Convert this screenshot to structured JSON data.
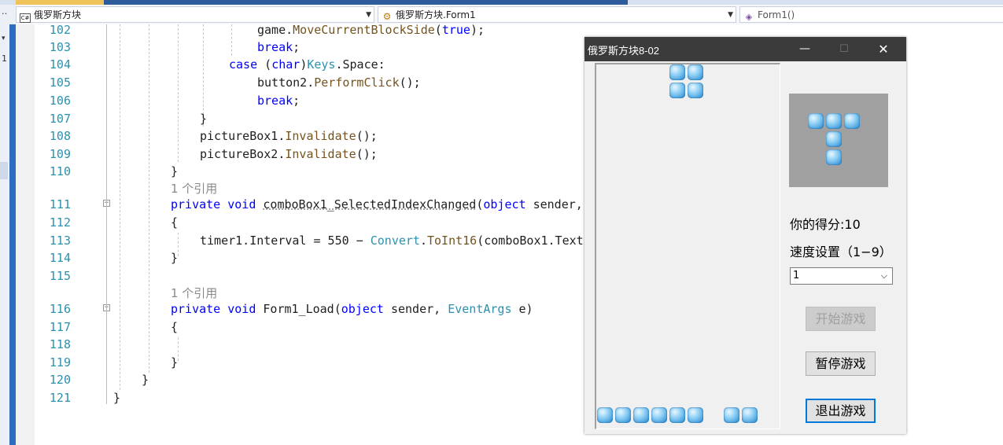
{
  "nav": {
    "project": "俄罗斯方块",
    "class": "俄罗斯方块.Form1",
    "member": "Form1()"
  },
  "left_marks": [
    "‥",
    "1"
  ],
  "lines": [
    {
      "num": "102",
      "code": "game.MoveCurrentBlockSide(true);"
    },
    {
      "num": "103",
      "code": "break;"
    },
    {
      "num": "104",
      "code": "case (char)Keys.Space:"
    },
    {
      "num": "105",
      "code": "button2.PerformClick();"
    },
    {
      "num": "106",
      "code": "break;"
    },
    {
      "num": "107",
      "code": "}"
    },
    {
      "num": "108",
      "code": "pictureBox1.Invalidate();"
    },
    {
      "num": "109",
      "code": "pictureBox2.Invalidate();"
    },
    {
      "num": "110",
      "code": "}"
    },
    {
      "num": "111",
      "code": "private void comboBox1_SelectedIndexChanged(object sender,"
    },
    {
      "num": "112",
      "code": "{"
    },
    {
      "num": "113",
      "code": "timer1.Interval = 550 - Convert.ToInt16(comboBox1.Text"
    },
    {
      "num": "114",
      "code": "}"
    },
    {
      "num": "115",
      "code": ""
    },
    {
      "num": "116",
      "code": "private void Form1_Load(object sender, EventArgs e)"
    },
    {
      "num": "117",
      "code": "{"
    },
    {
      "num": "118",
      "code": ""
    },
    {
      "num": "119",
      "code": "}"
    },
    {
      "num": "120",
      "code": "}"
    },
    {
      "num": "121",
      "code": "}"
    }
  ],
  "lens": [
    "1 个引用",
    "1 个引用"
  ],
  "game": {
    "title": "俄罗斯方块8-02",
    "minimize": "—",
    "maximize": "☐",
    "close": "✕",
    "score_label": "你的得分:10",
    "speed_label": "速度设置（1−9）",
    "speed_value": "1",
    "start_button": "开始游戏",
    "pause_button": "暂停游戏",
    "exit_button": "退出游戏",
    "block_color": "#3a97d8",
    "preview_bg": "#a0a0a0"
  }
}
